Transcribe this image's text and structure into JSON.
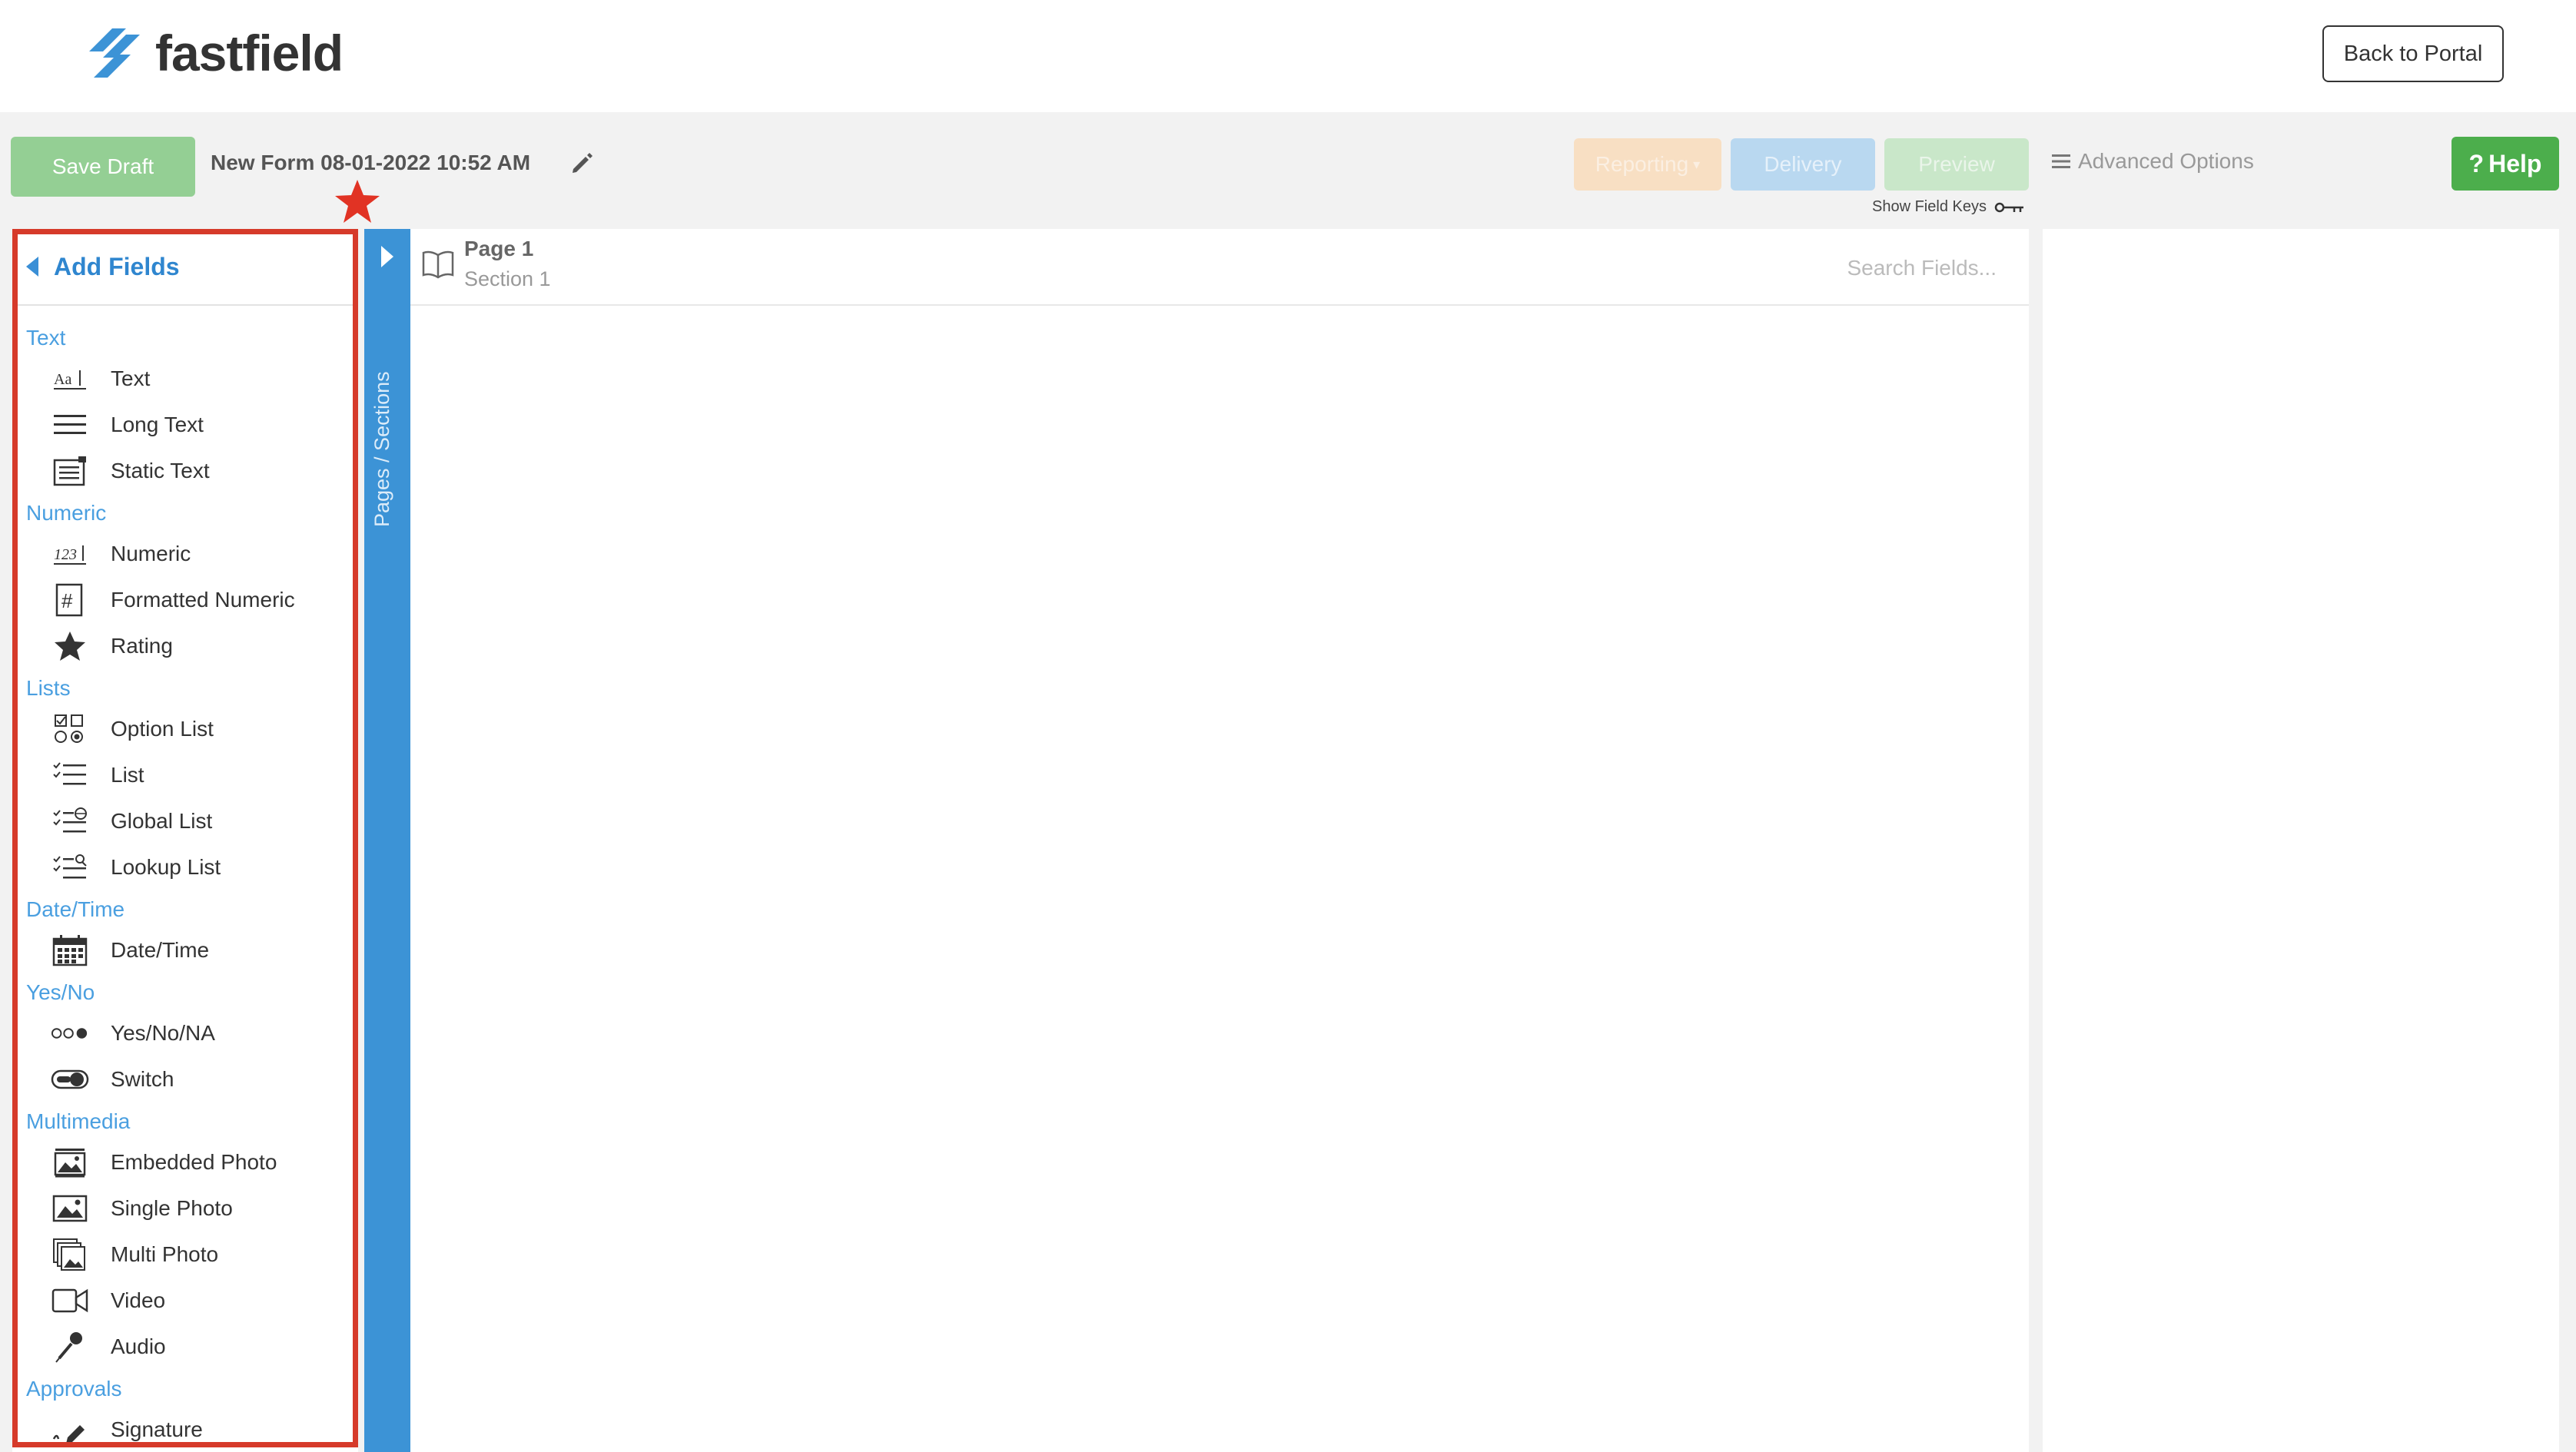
{
  "header": {
    "logo_text": "fastfield",
    "back_label": "Back to Portal"
  },
  "toolbar": {
    "save_draft": "Save Draft",
    "form_title": "New Form 08-01-2022 10:52 AM",
    "reporting": "Reporting",
    "delivery": "Delivery",
    "preview": "Preview",
    "advanced_options": "Advanced Options",
    "show_field_keys": "Show Field Keys",
    "help": "Help"
  },
  "add_fields": {
    "title": "Add Fields",
    "categories": [
      {
        "label": "Text",
        "items": [
          {
            "label": "Text",
            "icon": "text-field-icon"
          },
          {
            "label": "Long Text",
            "icon": "long-text-icon"
          },
          {
            "label": "Static Text",
            "icon": "static-text-icon"
          }
        ]
      },
      {
        "label": "Numeric",
        "items": [
          {
            "label": "Numeric",
            "icon": "numeric-icon"
          },
          {
            "label": "Formatted Numeric",
            "icon": "hash-icon"
          },
          {
            "label": "Rating",
            "icon": "star-icon"
          }
        ]
      },
      {
        "label": "Lists",
        "items": [
          {
            "label": "Option List",
            "icon": "option-list-icon"
          },
          {
            "label": "List",
            "icon": "list-icon"
          },
          {
            "label": "Global List",
            "icon": "global-list-icon"
          },
          {
            "label": "Lookup List",
            "icon": "lookup-list-icon"
          }
        ]
      },
      {
        "label": "Date/Time",
        "items": [
          {
            "label": "Date/Time",
            "icon": "calendar-icon"
          }
        ]
      },
      {
        "label": "Yes/No",
        "items": [
          {
            "label": "Yes/No/NA",
            "icon": "yes-no-na-icon"
          },
          {
            "label": "Switch",
            "icon": "switch-icon"
          }
        ]
      },
      {
        "label": "Multimedia",
        "items": [
          {
            "label": "Embedded Photo",
            "icon": "embedded-photo-icon"
          },
          {
            "label": "Single Photo",
            "icon": "single-photo-icon"
          },
          {
            "label": "Multi Photo",
            "icon": "multi-photo-icon"
          },
          {
            "label": "Video",
            "icon": "video-icon"
          },
          {
            "label": "Audio",
            "icon": "microphone-icon"
          }
        ]
      },
      {
        "label": "Approvals",
        "items": [
          {
            "label": "Signature",
            "icon": "signature-icon"
          }
        ]
      }
    ]
  },
  "pages_sections": {
    "label": "Pages / Sections"
  },
  "canvas": {
    "page_label": "Page 1",
    "section_label": "Section 1",
    "search_placeholder": "Search Fields..."
  },
  "colors": {
    "accent": "#3c93d6",
    "highlight": "#d63a2a",
    "help": "#4cae4c"
  }
}
